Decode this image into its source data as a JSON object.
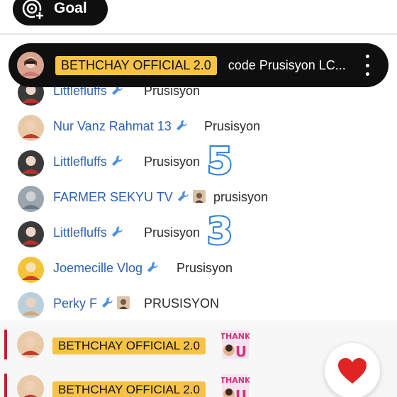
{
  "goal": {
    "label": "Goal",
    "icon": "goal-target-icon"
  },
  "pinned": {
    "author": "BETHCHAY OFFICIAL 2.0",
    "message": "code Prusisyon LC...",
    "menu_icon": "more-vertical-icon"
  },
  "chat": [
    {
      "author": "Littlefluffs",
      "moderator": true,
      "member": false,
      "text": "Prusisyon",
      "avatar": "avatar-littlefluffs"
    },
    {
      "author": "Nur Vanz Rahmat 13",
      "moderator": true,
      "member": false,
      "text": "Prusisyon",
      "avatar": "avatar-nur"
    },
    {
      "author": "Littlefluffs",
      "moderator": true,
      "member": false,
      "text": "Prusisyon",
      "avatar": "avatar-littlefluffs",
      "overlay": "5"
    },
    {
      "author": "FARMER SEKYU TV",
      "moderator": true,
      "member": true,
      "text": "prusisyon",
      "avatar": "avatar-farmer"
    },
    {
      "author": "Littlefluffs",
      "moderator": true,
      "member": false,
      "text": "Prusisyon",
      "avatar": "avatar-littlefluffs",
      "overlay": "3"
    },
    {
      "author": "Joemecille Vlog",
      "moderator": true,
      "member": false,
      "text": "Prusisyon",
      "avatar": "avatar-joemecille"
    },
    {
      "author": "Perky F",
      "moderator": true,
      "member": true,
      "text": "PRUSISYON",
      "avatar": "avatar-perky"
    }
  ],
  "highlighted": [
    {
      "author": "BETHCHAY OFFICIAL 2.0",
      "sticker": "thank-u-sticker"
    },
    {
      "author": "BETHCHAY OFFICIAL 2.0",
      "sticker": "thank-u-sticker"
    }
  ],
  "reaction_button": {
    "icon": "heart-icon",
    "color": "#e02424"
  },
  "colors": {
    "author": "#2c62b3",
    "owner_badge": "#f6c347",
    "accent": "#c0202a"
  }
}
